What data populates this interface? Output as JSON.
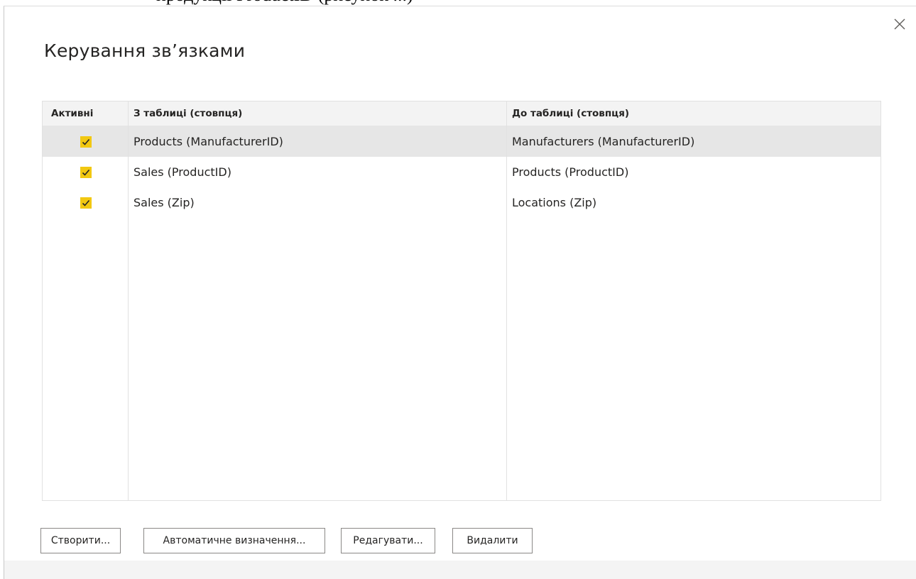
{
  "page_caption_fragment": "продукції ProductID (рисунок ...)",
  "dialog": {
    "title": "Керування зв’язками",
    "close_icon": "close-icon"
  },
  "table": {
    "columns": [
      "Активні",
      "З таблиці (стовпця)",
      "До таблиці (стовпця)"
    ],
    "rows": [
      {
        "active": true,
        "from": "Products (ManufacturerID)",
        "to": "Manufacturers (ManufacturerID)",
        "selected": true
      },
      {
        "active": true,
        "from": "Sales (ProductID)",
        "to": "Products (ProductID)",
        "selected": false
      },
      {
        "active": true,
        "from": "Sales (Zip)",
        "to": "Locations (Zip)",
        "selected": false
      }
    ]
  },
  "buttons": {
    "create": "Створити...",
    "autodetect": "Автоматичне визначення...",
    "edit": "Редагувати...",
    "delete": "Видалити"
  },
  "colors": {
    "checkbox": "#f2c811",
    "selected_row": "#e6e6e6",
    "header_bg": "#f3f3f3"
  }
}
